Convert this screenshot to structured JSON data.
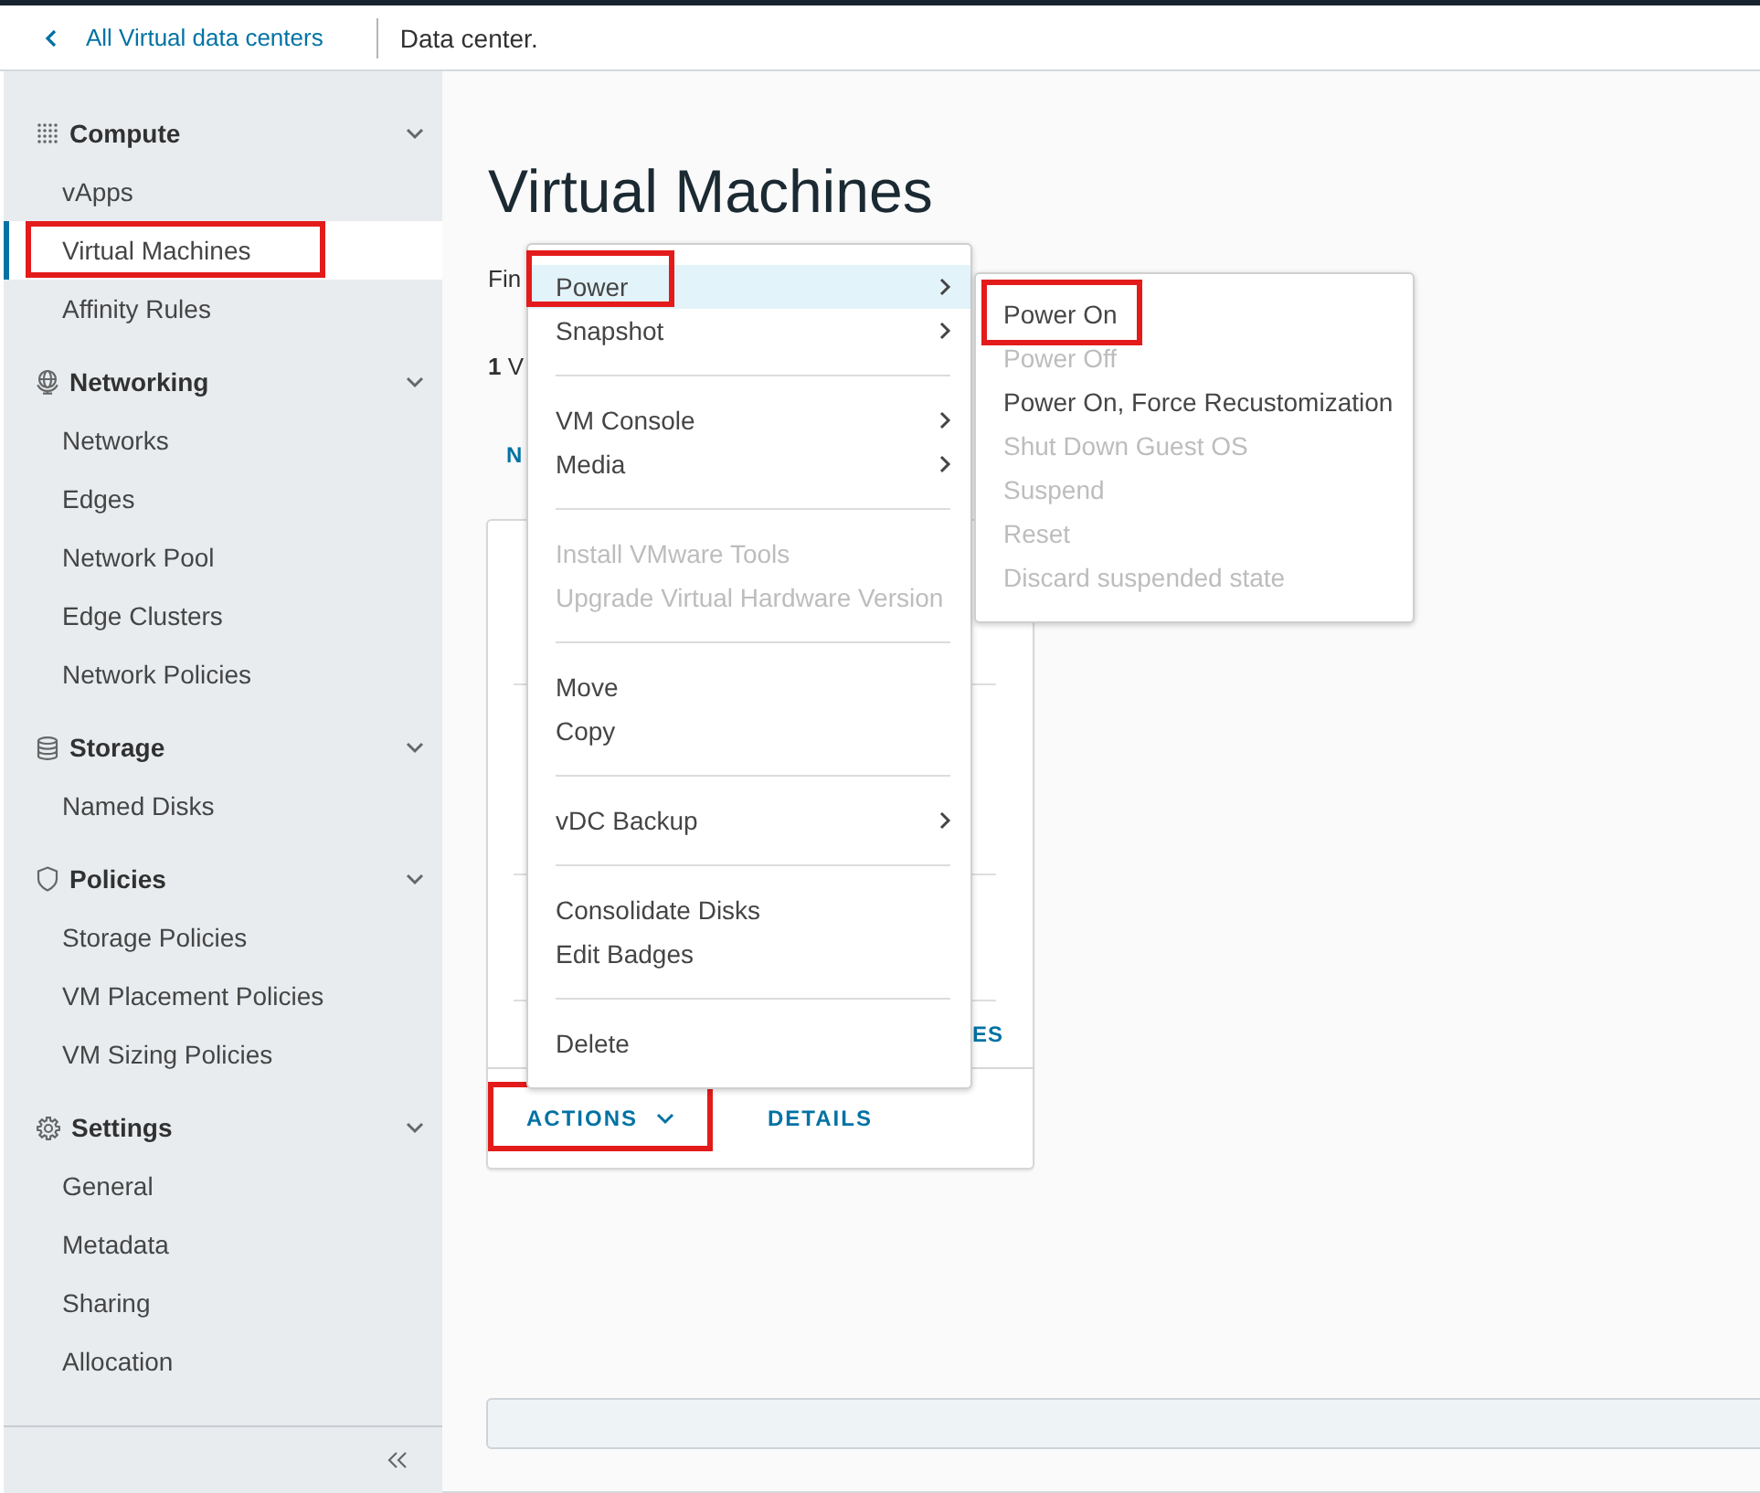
{
  "header": {
    "back_link": "All Virtual data centers",
    "title": "Data center."
  },
  "sidebar": {
    "groups": [
      {
        "label": "Compute",
        "expanded": true,
        "items": [
          {
            "label": "vApps",
            "selected": false,
            "annotated": false
          },
          {
            "label": "Virtual Machines",
            "selected": true,
            "annotated": true
          },
          {
            "label": "Affinity Rules",
            "selected": false,
            "annotated": false
          }
        ]
      },
      {
        "label": "Networking",
        "expanded": true,
        "items": [
          {
            "label": "Networks",
            "selected": false,
            "annotated": false
          },
          {
            "label": "Edges",
            "selected": false,
            "annotated": false
          },
          {
            "label": "Network Pool",
            "selected": false,
            "annotated": false
          },
          {
            "label": "Edge Clusters",
            "selected": false,
            "annotated": false
          },
          {
            "label": "Network Policies",
            "selected": false,
            "annotated": false
          }
        ]
      },
      {
        "label": "Storage",
        "expanded": true,
        "items": [
          {
            "label": "Named Disks",
            "selected": false,
            "annotated": false
          }
        ]
      },
      {
        "label": "Policies",
        "expanded": true,
        "items": [
          {
            "label": "Storage Policies",
            "selected": false,
            "annotated": false
          },
          {
            "label": "VM Placement Policies",
            "selected": false,
            "annotated": false
          },
          {
            "label": "VM Sizing Policies",
            "selected": false,
            "annotated": false
          }
        ]
      },
      {
        "label": "Settings",
        "expanded": true,
        "items": [
          {
            "label": "General",
            "selected": false,
            "annotated": false
          },
          {
            "label": "Metadata",
            "selected": false,
            "annotated": false
          },
          {
            "label": "Sharing",
            "selected": false,
            "annotated": false
          },
          {
            "label": "Allocation",
            "selected": false,
            "annotated": false
          }
        ]
      }
    ]
  },
  "main": {
    "title": "Virtual Machines",
    "filter_label": "Fin",
    "count": "**1** V",
    "toolbar_button": "N",
    "card": {
      "link": "ES",
      "buttons": [
        {
          "label": "ACTIONS",
          "kind": "dropdown",
          "annotated": true
        },
        {
          "label": "DETAILS",
          "kind": "plain",
          "annotated": false
        }
      ]
    }
  },
  "actions_menu": {
    "sections": [
      {
        "items": [
          {
            "label": "Power",
            "submenu": true,
            "disabled": false,
            "selected": true,
            "annotated": true
          },
          {
            "label": "Snapshot",
            "submenu": true,
            "disabled": false,
            "selected": false,
            "annotated": false
          }
        ]
      },
      {
        "items": [
          {
            "label": "VM Console",
            "submenu": true,
            "disabled": false,
            "selected": false,
            "annotated": false
          },
          {
            "label": "Media",
            "submenu": true,
            "disabled": false,
            "selected": false,
            "annotated": false
          }
        ]
      },
      {
        "items": [
          {
            "label": "Install VMware Tools",
            "submenu": false,
            "disabled": true,
            "selected": false,
            "annotated": false
          },
          {
            "label": "Upgrade Virtual Hardware Version",
            "submenu": false,
            "disabled": true,
            "selected": false,
            "annotated": false
          }
        ]
      },
      {
        "items": [
          {
            "label": "Move",
            "submenu": false,
            "disabled": false,
            "selected": false,
            "annotated": false
          },
          {
            "label": "Copy",
            "submenu": false,
            "disabled": false,
            "selected": false,
            "annotated": false
          }
        ]
      },
      {
        "items": [
          {
            "label": "vDC Backup",
            "submenu": true,
            "disabled": false,
            "selected": false,
            "annotated": false
          }
        ]
      },
      {
        "items": [
          {
            "label": "Consolidate Disks",
            "submenu": false,
            "disabled": false,
            "selected": false,
            "annotated": false
          },
          {
            "label": "Edit Badges",
            "submenu": false,
            "disabled": false,
            "selected": false,
            "annotated": false
          }
        ]
      },
      {
        "items": [
          {
            "label": "Delete",
            "submenu": false,
            "disabled": false,
            "selected": false,
            "annotated": false
          }
        ]
      }
    ]
  },
  "power_submenu": {
    "items": [
      {
        "label": "Power On",
        "disabled": false,
        "annotated": true
      },
      {
        "label": "Power Off",
        "disabled": true,
        "annotated": false
      },
      {
        "label": "Power On, Force Recustomization",
        "disabled": false,
        "annotated": false
      },
      {
        "label": "Shut Down Guest OS",
        "disabled": true,
        "annotated": false
      },
      {
        "label": "Suspend",
        "disabled": true,
        "annotated": false
      },
      {
        "label": "Reset",
        "disabled": true,
        "annotated": false
      },
      {
        "label": "Discard suspended state",
        "disabled": true,
        "annotated": false
      }
    ]
  }
}
